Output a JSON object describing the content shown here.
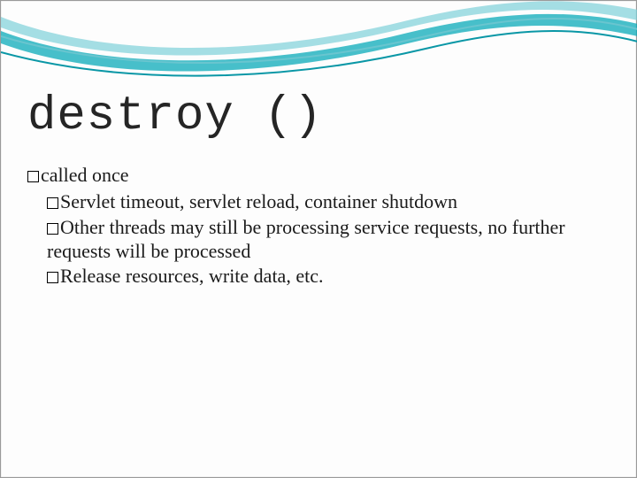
{
  "title": "destroy ()",
  "bullets": {
    "lvl1": "called once",
    "sub": [
      "Servlet timeout, servlet reload, container shutdown",
      "Other threads may still be processing service requests, no further requests will be processed",
      "Release resources, write data, etc."
    ]
  }
}
